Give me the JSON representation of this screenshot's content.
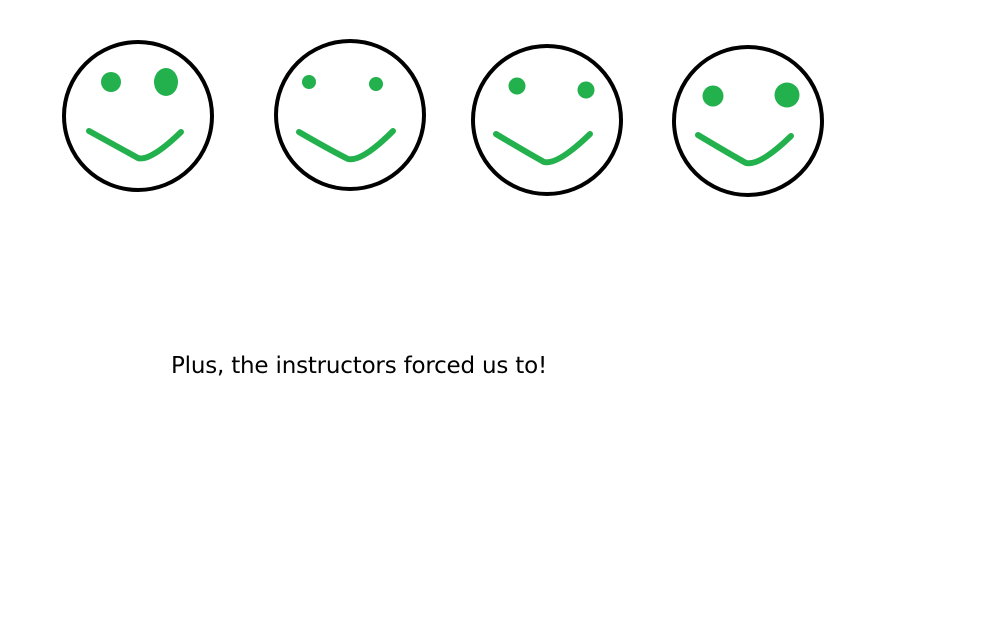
{
  "caption": "Plus, the instructors forced us to!",
  "colors": {
    "background": "#ffffff",
    "outline": "#000000",
    "features": "#22b14c",
    "text": "#000000"
  },
  "icons": [
    "smiley-face-icon",
    "smiley-face-icon",
    "smiley-face-icon",
    "smiley-face-icon"
  ]
}
